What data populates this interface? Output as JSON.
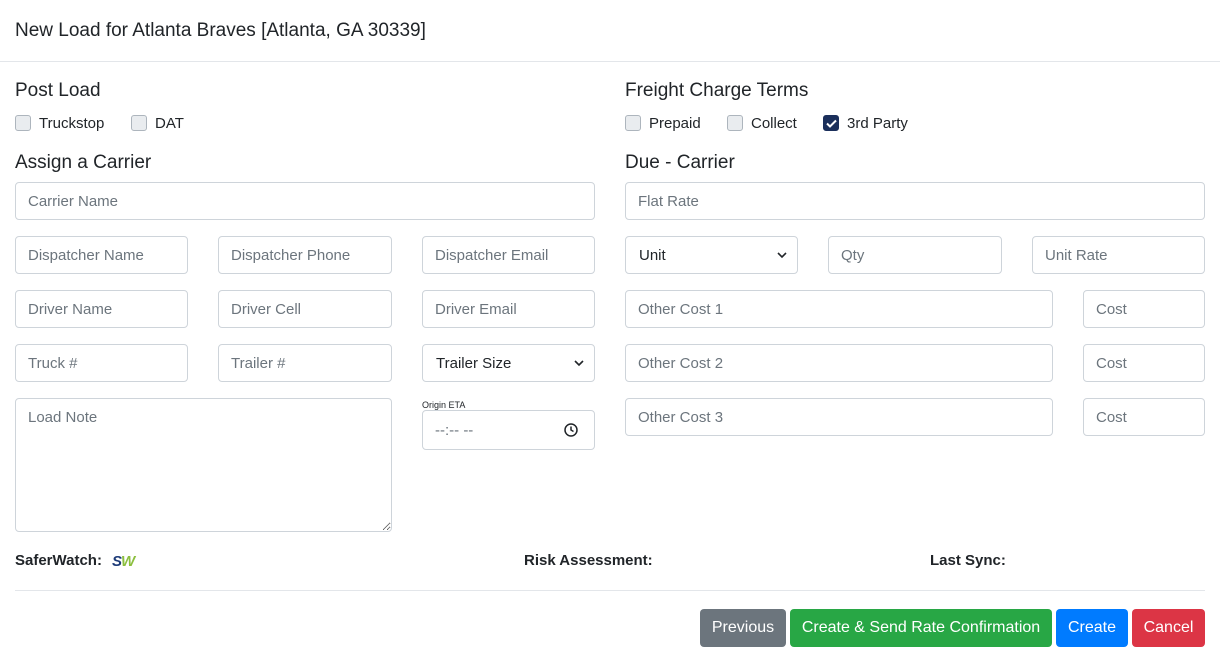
{
  "modal": {
    "title": "New Load for Atlanta Braves [Atlanta, GA 30339]"
  },
  "post_load": {
    "title": "Post Load",
    "options": [
      {
        "label": "Truckstop",
        "checked": false
      },
      {
        "label": "DAT",
        "checked": false
      }
    ]
  },
  "freight_terms": {
    "title": "Freight Charge Terms",
    "options": [
      {
        "label": "Prepaid",
        "checked": false
      },
      {
        "label": "Collect",
        "checked": false
      },
      {
        "label": "3rd Party",
        "checked": true
      }
    ]
  },
  "assign_carrier": {
    "title": "Assign a Carrier",
    "carrier_name": "Carrier Name",
    "dispatcher_name": "Dispatcher Name",
    "dispatcher_phone": "Dispatcher Phone",
    "dispatcher_email": "Dispatcher Email",
    "driver_name": "Driver Name",
    "driver_cell": "Driver Cell",
    "driver_email": "Driver Email",
    "truck": "Truck #",
    "trailer": "Trailer #",
    "trailer_size": "Trailer Size",
    "load_note": "Load Note",
    "origin_eta_label": "Origin ETA",
    "origin_eta_value": "--:-- --"
  },
  "due_carrier": {
    "title": "Due - Carrier",
    "flat_rate": "Flat Rate",
    "unit": "Unit",
    "qty": "Qty",
    "unit_rate": "Unit Rate",
    "other_cost_1": "Other Cost 1",
    "other_cost_2": "Other Cost 2",
    "other_cost_3": "Other Cost 3",
    "cost": "Cost"
  },
  "footer_info": {
    "saferwatch_label": "SaferWatch:",
    "sw_logo": "SW",
    "risk_label": "Risk Assessment:",
    "sync_label": "Last Sync:"
  },
  "buttons": {
    "previous": "Previous",
    "create_send": "Create & Send Rate Confirmation",
    "create": "Create",
    "cancel": "Cancel"
  },
  "colors": {
    "previous": "#6c757d",
    "create_send": "#28a745",
    "create": "#007bff",
    "cancel": "#dc3545",
    "checkbox_checked": "#1b2f5b",
    "sw_blue": "#1d3b78",
    "sw_green": "#8cbf3f"
  },
  "icons": {
    "clock": "clock-icon",
    "chevron": "chevron-down-icon",
    "check": "check-icon"
  }
}
